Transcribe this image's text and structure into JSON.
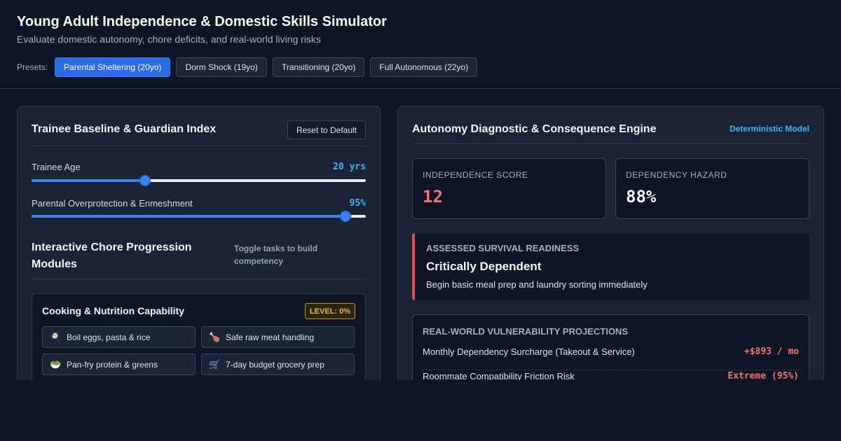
{
  "header": {
    "title": "Young Adult Independence & Domestic Skills Simulator",
    "subtitle": "Evaluate domestic autonomy, chore deficits, and real-world living risks",
    "presets_label": "Presets:",
    "presets": [
      {
        "label": "Parental Sheltering (20yo)",
        "active": true
      },
      {
        "label": "Dorm Shock (19yo)",
        "active": false
      },
      {
        "label": "Transitioning (20yo)",
        "active": false
      },
      {
        "label": "Full Autonomous (22yo)",
        "active": false
      }
    ]
  },
  "left_panel": {
    "title": "Trainee Baseline & Guardian Index",
    "reset_label": "Reset to Default",
    "sliders": [
      {
        "label": "Trainee Age",
        "value_text": "20 yrs",
        "fraction": 0.34
      },
      {
        "label": "Parental Overprotection & Enmeshment",
        "value_text": "95%",
        "fraction": 0.94
      }
    ],
    "section_title": "Interactive Chore Progression Modules",
    "section_hint": "Toggle tasks to build competency",
    "module": {
      "title": "Cooking & Nutrition Capability",
      "level": "LEVEL: 0%",
      "tasks": [
        {
          "icon": "🍳",
          "icon_name": "frying-pan-egg-icon",
          "label": "Boil eggs, pasta & rice"
        },
        {
          "icon": "🍗",
          "icon_name": "poultry-leg-icon",
          "label": "Safe raw meat handling"
        },
        {
          "icon": "🥗",
          "icon_name": "salad-bowl-icon",
          "label": "Pan-fry protein & greens"
        },
        {
          "icon": "🛒",
          "icon_name": "shopping-cart-icon",
          "label": "7-day budget grocery prep"
        }
      ]
    }
  },
  "right_panel": {
    "title": "Autonomy Diagnostic & Consequence Engine",
    "model_tag": "Deterministic Model",
    "stats": [
      {
        "label": "INDEPENDENCE SCORE",
        "value": "12",
        "color": "#f87171"
      },
      {
        "label": "DEPENDENCY HAZARD",
        "value": "88%",
        "color": "#f1f4f9"
      }
    ],
    "readiness": {
      "label": "ASSESSED SURVIVAL READINESS",
      "title": "Critically Dependent",
      "description": "Begin basic meal prep and laundry sorting immediately",
      "accent": "#e5484d"
    },
    "vulnerability": {
      "title": "REAL-WORLD VULNERABILITY PROJECTIONS",
      "rows": [
        {
          "label": "Monthly Dependency Surcharge (Takeout & Service)",
          "value": "+$893 / mo"
        },
        {
          "label": "Roommate Compatibility Friction Risk",
          "value": "Extreme (95%)"
        }
      ]
    }
  }
}
